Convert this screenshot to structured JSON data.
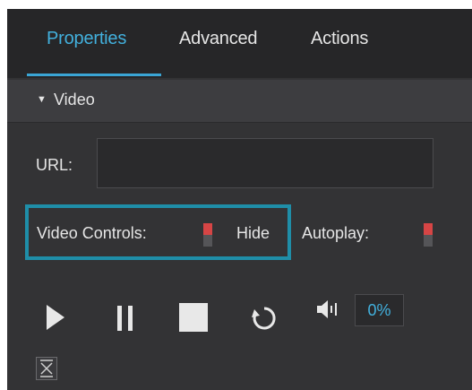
{
  "tabs": [
    {
      "label": "Properties",
      "active": true
    },
    {
      "label": "Advanced",
      "active": false
    },
    {
      "label": "Actions",
      "active": false
    }
  ],
  "section": {
    "arrow": "▼",
    "title": "Video"
  },
  "url": {
    "label": "URL:",
    "value": ""
  },
  "video_controls": {
    "label": "Video Controls:",
    "state_label": "Hide"
  },
  "autoplay": {
    "label": "Autoplay:"
  },
  "playback": {
    "icons": [
      "play-icon",
      "pause-icon",
      "stop-icon",
      "replay-icon",
      "volume-icon",
      "collapse-icon"
    ],
    "volume": "0%"
  },
  "colors": {
    "accent": "#42b0dd",
    "highlight": "#1f8ea8",
    "toggle_on": "#d64545",
    "panel_bg": "#333335"
  }
}
